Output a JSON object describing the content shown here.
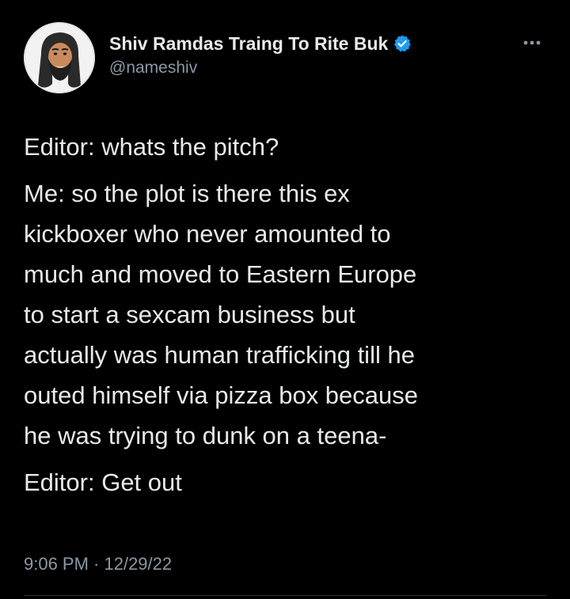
{
  "tweet": {
    "author": {
      "display_name": "Shiv Ramdas Traing To Rite Buk",
      "handle": "@nameshiv",
      "verified": true,
      "avatar_icon": "cartoon-bearded-man-avatar"
    },
    "more_icon": "more-horizontal-icon",
    "paragraphs": [
      "Editor: whats the pitch?",
      "Me: so the plot is there this ex\nkickboxer who never amounted to\nmuch and moved to Eastern Europe\nto start a sexcam business but\nactually was human trafficking till he\nouted himself via pizza box because\nhe was trying to dunk on a teena-",
      "Editor: Get out"
    ],
    "timestamp": "9:06 PM · 12/29/22"
  },
  "colors": {
    "background": "#000000",
    "primary_text": "#e7e9ea",
    "secondary_text": "#8b98a5",
    "verified_badge": "#1d9bf0",
    "divider": "#2f3336"
  }
}
